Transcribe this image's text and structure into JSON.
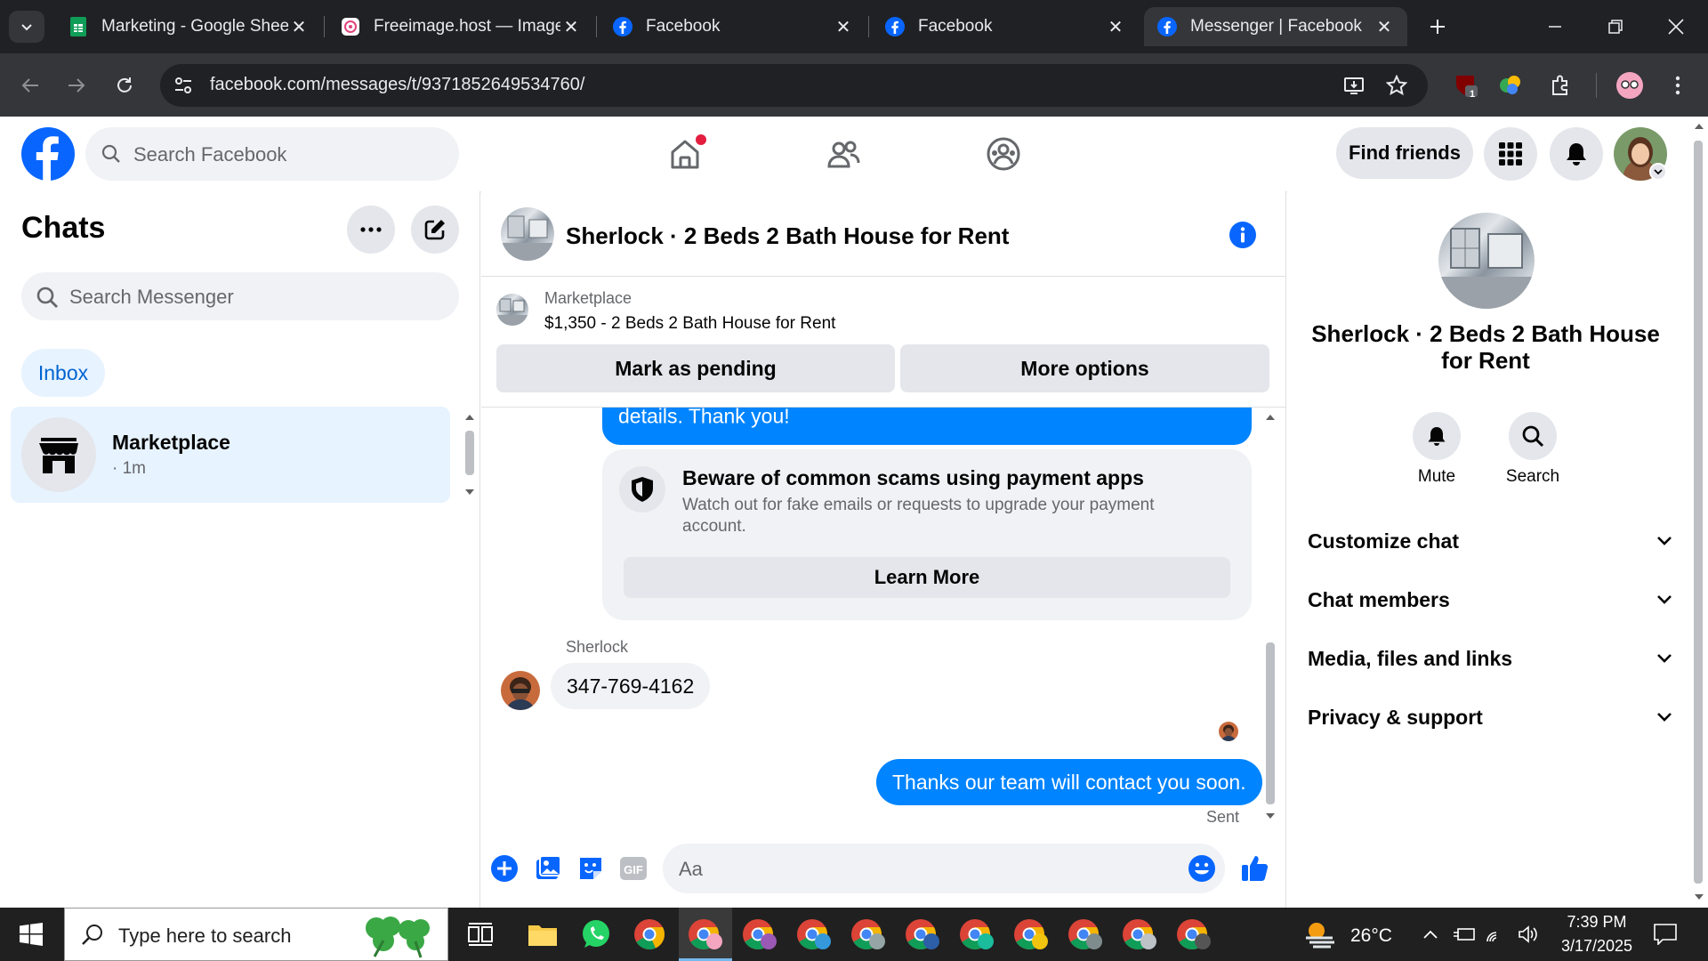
{
  "browser": {
    "tabs": [
      {
        "title": "Marketing - Google Shee",
        "icon": "google-sheets-icon"
      },
      {
        "title": "Freeimage.host — Image",
        "icon": "freeimage-icon"
      },
      {
        "title": "Facebook",
        "icon": "facebook-icon"
      },
      {
        "title": "Facebook",
        "icon": "facebook-icon"
      },
      {
        "title": "Messenger | Facebook",
        "icon": "facebook-icon",
        "active": true
      }
    ],
    "url": "facebook.com/messages/t/9371852649534760/",
    "extension_badge": "1"
  },
  "facebook": {
    "search_placeholder": "Search Facebook",
    "find_friends_label": "Find friends",
    "brand_color": "#0866ff"
  },
  "chats": {
    "title": "Chats",
    "search_placeholder": "Search Messenger",
    "filter_label": "Inbox",
    "conversations": [
      {
        "name": "Marketplace",
        "time": "· 1m"
      }
    ]
  },
  "conversation": {
    "title": "Sherlock · 2 Beds 2 Bath House for Rent",
    "marketplace_label": "Marketplace",
    "listing": "$1,350 - 2 Beds 2 Bath House for Rent",
    "mark_pending_label": "Mark as pending",
    "more_options_label": "More options",
    "outgoing_partial": "details. Thank you!",
    "scam_warning": {
      "title": "Beware of common scams using payment apps",
      "body": "Watch out for fake emails or requests to upgrade your payment account.",
      "button": "Learn More"
    },
    "sender_name": "Sherlock",
    "incoming_message": "347-769-4162",
    "outgoing_message": "Thanks our team will contact you soon.",
    "status": "Sent",
    "composer_placeholder": "Aa",
    "outgoing_color": "#0084ff"
  },
  "info_panel": {
    "name": "Sherlock · 2 Beds 2 Bath House for Rent",
    "mute_label": "Mute",
    "search_label": "Search",
    "sections": [
      "Customize chat",
      "Chat members",
      "Media, files and links",
      "Privacy & support"
    ]
  },
  "taskbar": {
    "search_placeholder": "Type here to search",
    "temperature": "26°C",
    "time": "7:39 PM",
    "date": "3/17/2025"
  }
}
